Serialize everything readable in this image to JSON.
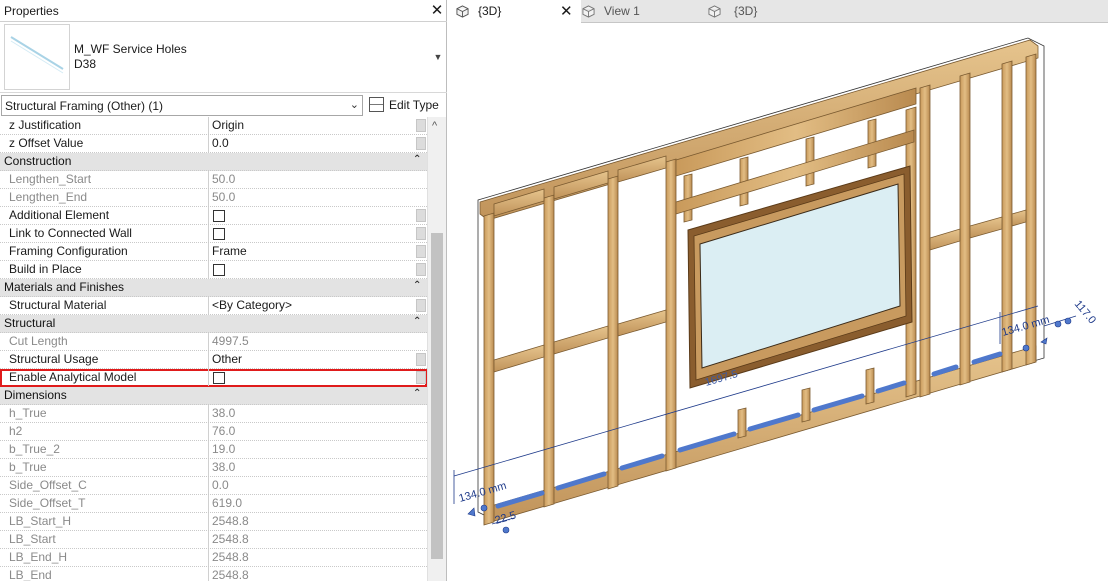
{
  "palette": {
    "title": "Properties",
    "close_glyph": "✕",
    "type_name": "M_WF Service Holes",
    "type_subname": "D38",
    "filter_value": "Structural Framing (Other) (1)",
    "edit_type_label": "Edit Type",
    "icons": {
      "thumbnail": "family-thumbnail-icon",
      "edit_type": "edit-type-icon",
      "dropdown": "chevron-down-icon",
      "collapse": "collapse-section-icon"
    }
  },
  "grid": {
    "rows": [
      {
        "kind": "prop",
        "label": "z Justification",
        "value": "Origin",
        "gray": false
      },
      {
        "kind": "prop",
        "label": "z Offset Value",
        "value": "0.0",
        "gray": false
      },
      {
        "kind": "group",
        "label": "Construction"
      },
      {
        "kind": "prop",
        "label": "Lengthen_Start",
        "value": "50.0",
        "gray": true
      },
      {
        "kind": "prop",
        "label": "Lengthen_End",
        "value": "50.0",
        "gray": true
      },
      {
        "kind": "check",
        "label": "Additional Element",
        "checked": false
      },
      {
        "kind": "check",
        "label": "Link to Connected Wall",
        "checked": false
      },
      {
        "kind": "prop",
        "label": "Framing Configuration",
        "value": "Frame",
        "gray": false
      },
      {
        "kind": "check",
        "label": "Build in Place",
        "checked": false
      },
      {
        "kind": "group",
        "label": "Materials and Finishes"
      },
      {
        "kind": "prop",
        "label": "Structural Material",
        "value": "<By Category>",
        "gray": false
      },
      {
        "kind": "group",
        "label": "Structural"
      },
      {
        "kind": "prop",
        "label": "Cut Length",
        "value": "4997.5",
        "gray": true
      },
      {
        "kind": "prop",
        "label": "Structural Usage",
        "value": "Other",
        "gray": false
      },
      {
        "kind": "check",
        "label": "Enable Analytical Model",
        "checked": false,
        "highlighted": true
      },
      {
        "kind": "group",
        "label": "Dimensions"
      },
      {
        "kind": "prop",
        "label": "h_True",
        "value": "38.0",
        "gray": true
      },
      {
        "kind": "prop",
        "label": "h2",
        "value": "76.0",
        "gray": true
      },
      {
        "kind": "prop",
        "label": "b_True_2",
        "value": "19.0",
        "gray": true
      },
      {
        "kind": "prop",
        "label": "b_True",
        "value": "38.0",
        "gray": true
      },
      {
        "kind": "prop",
        "label": "Side_Offset_C",
        "value": "0.0",
        "gray": true
      },
      {
        "kind": "prop",
        "label": "Side_Offset_T",
        "value": "619.0",
        "gray": true
      },
      {
        "kind": "prop",
        "label": "LB_Start_H",
        "value": "2548.8",
        "gray": true
      },
      {
        "kind": "prop",
        "label": "LB_Start",
        "value": "2548.8",
        "gray": true
      },
      {
        "kind": "prop",
        "label": "LB_End_H",
        "value": "2548.8",
        "gray": true
      },
      {
        "kind": "prop",
        "label": "LB_End",
        "value": "2548.8",
        "gray": true
      }
    ]
  },
  "tabs": [
    {
      "label": "{3D}",
      "active": true,
      "icon": "3d-view-cube-icon"
    },
    {
      "label": "View 1",
      "active": false,
      "icon": "3d-view-cube-icon"
    },
    {
      "label": "{3D}",
      "active": false,
      "icon": "3d-view-cube-icon"
    }
  ],
  "tab_close_glyph": "✕",
  "view": {
    "dimensions": {
      "left": "134.0 mm",
      "right": "134.0 mm",
      "far_right": "117.0",
      "bottom": "22.5",
      "window": "1697.5"
    },
    "colors": {
      "timber": "#dcb479",
      "timber_dark": "#b8894e",
      "glass": "#dbeef3",
      "hole": "#7f9fdc",
      "dimension": "#1e3a8a",
      "highlight": "#e01b1b"
    }
  }
}
